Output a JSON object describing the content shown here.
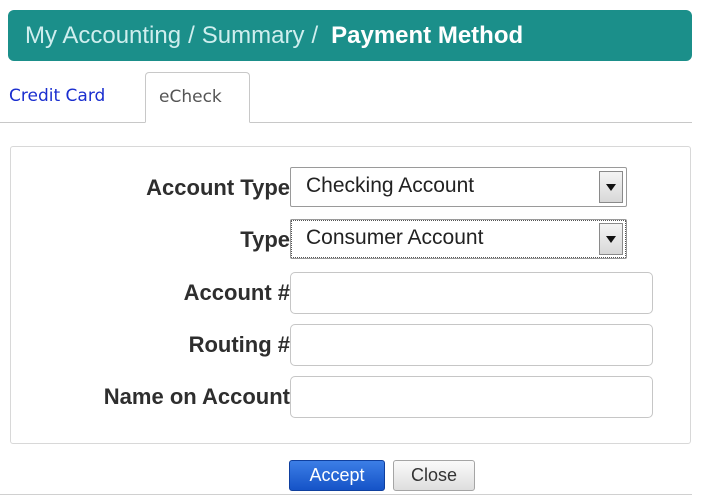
{
  "breadcrumb": {
    "items": [
      "My Accounting",
      "Summary"
    ],
    "separator": "/",
    "current": "Payment Method"
  },
  "tabs": [
    {
      "label": "Credit Card",
      "active": false
    },
    {
      "label": "eCheck",
      "active": true
    }
  ],
  "form": {
    "account_type": {
      "label": "Account Type",
      "value": "Checking Account"
    },
    "type": {
      "label": "Type",
      "value": "Consumer Account"
    },
    "account_number": {
      "label": "Account #",
      "value": ""
    },
    "routing_number": {
      "label": "Routing #",
      "value": ""
    },
    "name_on_account": {
      "label": "Name on Account",
      "value": ""
    }
  },
  "buttons": {
    "accept": "Accept",
    "close": "Close"
  },
  "colors": {
    "header": "#1b8f8a",
    "link": "#1a2ecf",
    "accept": "#1553c7"
  }
}
